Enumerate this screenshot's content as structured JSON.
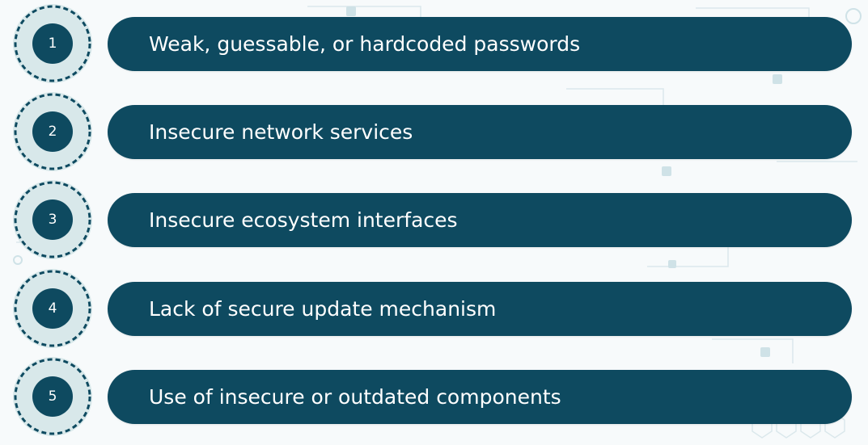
{
  "colors": {
    "accent": "#0e4a60",
    "badge_fill": "#d8e8ea",
    "background": "#f7fafb",
    "text": "#ffffff"
  },
  "items": [
    {
      "number": "1",
      "label": "Weak, guessable, or hardcoded passwords"
    },
    {
      "number": "2",
      "label": "Insecure network services"
    },
    {
      "number": "3",
      "label": "Insecure ecosystem interfaces"
    },
    {
      "number": "4",
      "label": "Lack of secure update mechanism"
    },
    {
      "number": "5",
      "label": "Use of insecure or outdated components"
    }
  ]
}
